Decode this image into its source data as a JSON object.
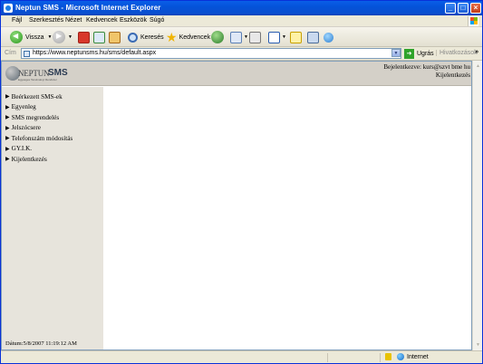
{
  "window": {
    "title": "Neptun SMS - Microsoft Internet Explorer",
    "controls": [
      "minimize",
      "maximize",
      "close"
    ]
  },
  "menubar": {
    "items": [
      "Fájl",
      "Szerkesztés",
      "Nézet",
      "Kedvencek",
      "Eszközök",
      "Súgó"
    ]
  },
  "toolbar": {
    "back_label": "Vissza",
    "search_label": "Keresés",
    "favorites_label": "Kedvencek"
  },
  "address": {
    "label": "Cím",
    "url": "https://www.neptunsms.hu/sms/default.aspx",
    "go_label": "Ugrás",
    "links_label": "Hivatkozások"
  },
  "site": {
    "logo_text_1": "NEPTUN",
    "logo_text_2": "SMS",
    "logo_tagline": "Egységes Tanulmányi Rendszer",
    "logged_in_label": "Bejelentkezve: kurs@szvt bme hu",
    "logout_label": "Kijelentkezés"
  },
  "sidebar": {
    "items": [
      "Beérkezett SMS-ek",
      "Egyenleg",
      "SMS megrendelés",
      "Jelszócsere",
      "Telefonszám módosítás",
      "GY.I.K.",
      "Kijelentkezés"
    ],
    "date_text": "Dátum:5/8/2007 11:19:12 AM"
  },
  "statusbar": {
    "zone": "Internet"
  },
  "colors": {
    "titlebar": "#0453d9",
    "chrome": "#ece9d8",
    "header": "#d4d0c8",
    "sidebar": "#e7e4dc"
  }
}
